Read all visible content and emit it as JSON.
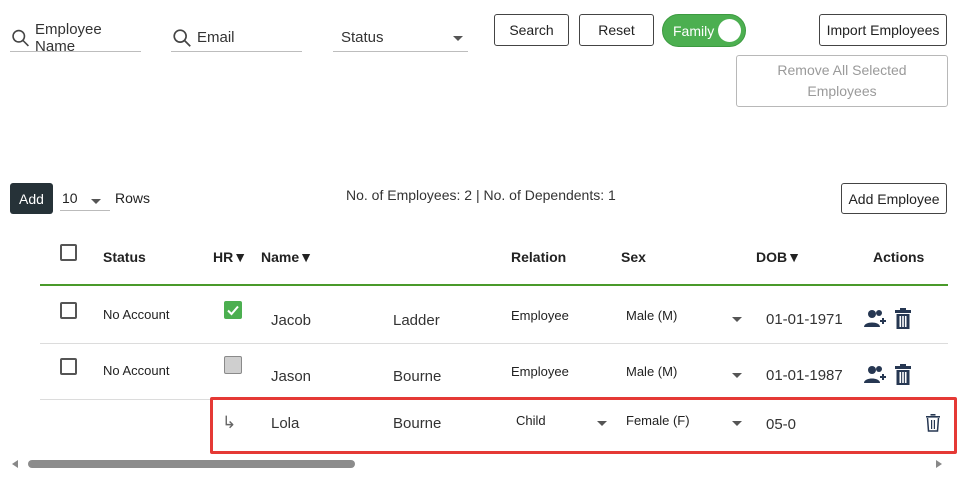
{
  "filters": {
    "employee_name_placeholder": "Employee Name",
    "email_placeholder": "Email",
    "status_placeholder": "Status"
  },
  "toolbar": {
    "search_label": "Search",
    "reset_label": "Reset",
    "family_label": "Family",
    "family_on": true,
    "import_label": "Import Employees",
    "remove_selected_line1": "Remove All Selected",
    "remove_selected_line2": "Employees"
  },
  "table_controls": {
    "add_label": "Add",
    "rows_value": "10",
    "rows_label": "Rows",
    "summary": "No. of Employees: 2 | No. of Dependents: 1",
    "add_employee_label": "Add Employee"
  },
  "columns": {
    "status": "Status",
    "hr": "HR▼",
    "name": "Name▼",
    "relation": "Relation",
    "sex": "Sex",
    "dob": "DOB▼",
    "actions": "Actions"
  },
  "rows": [
    {
      "status": "No Account",
      "hr_checked": true,
      "first_name": "Jacob",
      "last_name": "Ladder",
      "relation": "Employee",
      "sex": "Male (M)",
      "dob": "01-01-1971"
    },
    {
      "status": "No Account",
      "hr_checked": false,
      "first_name": "Jason",
      "last_name": "Bourne",
      "relation": "Employee",
      "sex": "Male (M)",
      "dob": "01-01-1987"
    }
  ],
  "dependent_row": {
    "arrow": "↳",
    "first_name": "Lola",
    "last_name": "Bourne",
    "relation": "Child",
    "sex": "Female (F)",
    "dob": "05-0"
  },
  "colors": {
    "accent_green": "#4caf50",
    "header_underline": "#4a9a2a",
    "highlight_red": "#e53935",
    "icon_navy": "#263752",
    "dark_button": "#263238"
  }
}
